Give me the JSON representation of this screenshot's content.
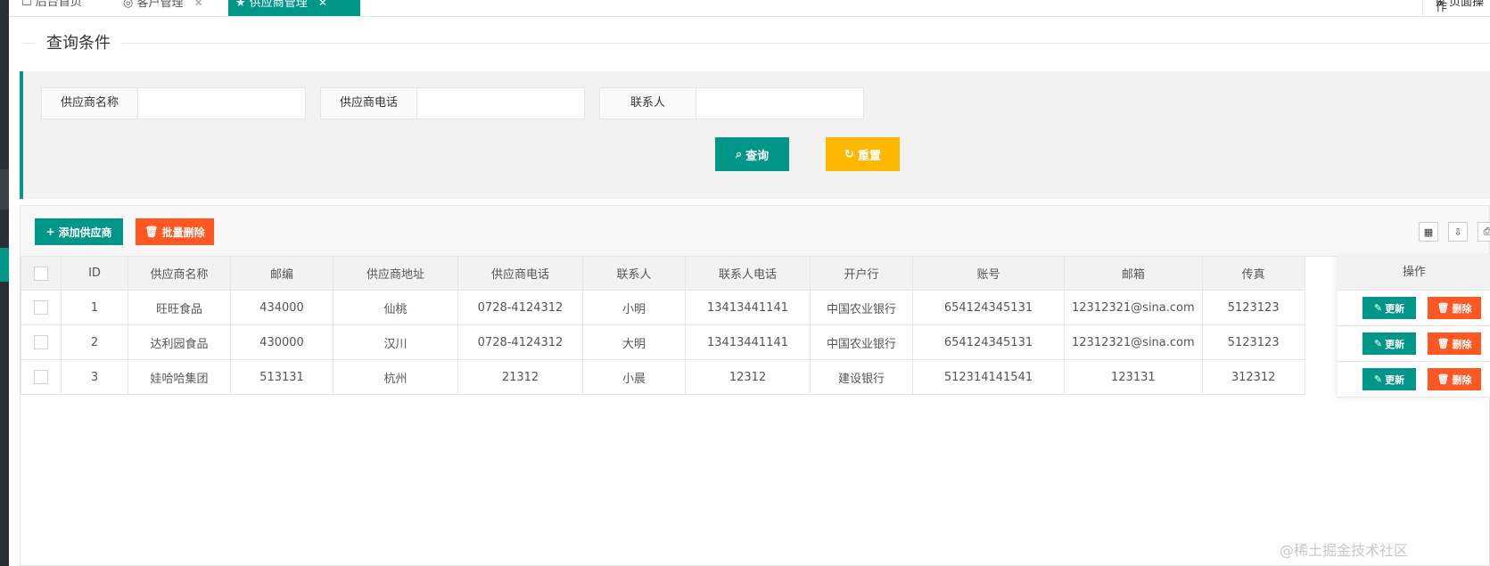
{
  "tabs": {
    "home": "后台首页",
    "customer": "客户管理",
    "supplier": "供应商管理",
    "close_glyph": "✕",
    "right_label": "页面操作"
  },
  "query": {
    "legend": "查询条件",
    "fields": {
      "name_label": "供应商名称",
      "name_value": "",
      "phone_label": "供应商电话",
      "phone_value": "",
      "contact_label": "联系人",
      "contact_value": ""
    },
    "query_button": "查询",
    "reset_button": "重置"
  },
  "toolbar": {
    "add_button": "添加供应商",
    "batch_delete_button": "批量删除"
  },
  "table": {
    "columns": [
      "ID",
      "供应商名称",
      "邮编",
      "供应商地址",
      "供应商电话",
      "联系人",
      "联系人电话",
      "开户行",
      "账号",
      "邮箱",
      "传真"
    ],
    "ops_header": "操作",
    "update_label": "更新",
    "delete_label": "删除",
    "rows": [
      [
        "1",
        "旺旺食品",
        "434000",
        "仙桃",
        "0728-4124312",
        "小明",
        "13413441141",
        "中国农业银行",
        "654124345131",
        "12312321@sina.com",
        "5123123"
      ],
      [
        "2",
        "达利园食品",
        "430000",
        "汉川",
        "0728-4124312",
        "大明",
        "13413441141",
        "中国农业银行",
        "654124345131",
        "12312321@sina.com",
        "5123123"
      ],
      [
        "3",
        "娃哈哈集团",
        "513131",
        "杭州",
        "21312",
        "小晨",
        "12312",
        "建设银行",
        "512314141541",
        "123131",
        "312312"
      ]
    ]
  },
  "watermark": "@稀土掘金技术社区",
  "colors": {
    "primary": "#009688",
    "warm": "#ffb800",
    "danger": "#ff5722"
  }
}
